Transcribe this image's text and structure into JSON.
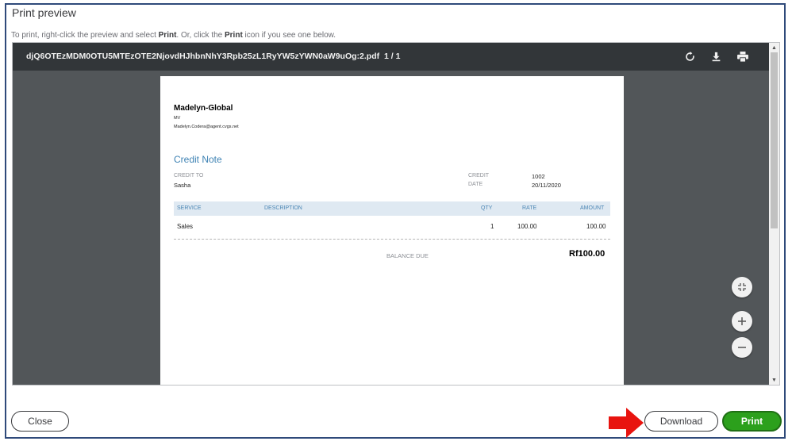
{
  "dialog": {
    "title": "Print preview",
    "hint_prefix": "To print, right-click the preview and select ",
    "hint_print1": "Print",
    "hint_middle": ". Or, click the ",
    "hint_print2": "Print",
    "hint_suffix": " icon if you see one below."
  },
  "viewer": {
    "filename": "djQ6OTEzMDM0OTU5MTEzOTE2NjovdHJhbnNhY3Rpb25zL1RyYW5zYWN0aW9uOg:2.pdf",
    "page_indicator": "1 / 1",
    "toolbar_icons": [
      "rotate-icon",
      "download-icon",
      "print-icon"
    ]
  },
  "document": {
    "company_name": "Madelyn-Global",
    "company_initials": "MV",
    "company_email": "Madelyn.Codera@agent.cvgs.net",
    "doc_title": "Credit Note",
    "credit_to_label": "CREDIT TO",
    "credit_to_value": "Sasha",
    "credit_label": "CREDIT",
    "credit_value": "1002",
    "date_label": "DATE",
    "date_value": "20/11/2020",
    "columns": {
      "service": "SERVICE",
      "description": "DESCRIPTION",
      "qty": "QTY",
      "rate": "RATE",
      "amount": "AMOUNT"
    },
    "rows": [
      {
        "service": "Sales",
        "description": "",
        "qty": "1",
        "rate": "100.00",
        "amount": "100.00"
      }
    ],
    "balance_due_label": "BALANCE DUE",
    "balance_due_value": "Rf100.00"
  },
  "footer": {
    "close_label": "Close",
    "download_label": "Download",
    "print_label": "Print"
  },
  "colors": {
    "accent_blue": "#3f83b4",
    "print_green": "#2ca01c",
    "annotation_arrow": "#e8140f"
  }
}
